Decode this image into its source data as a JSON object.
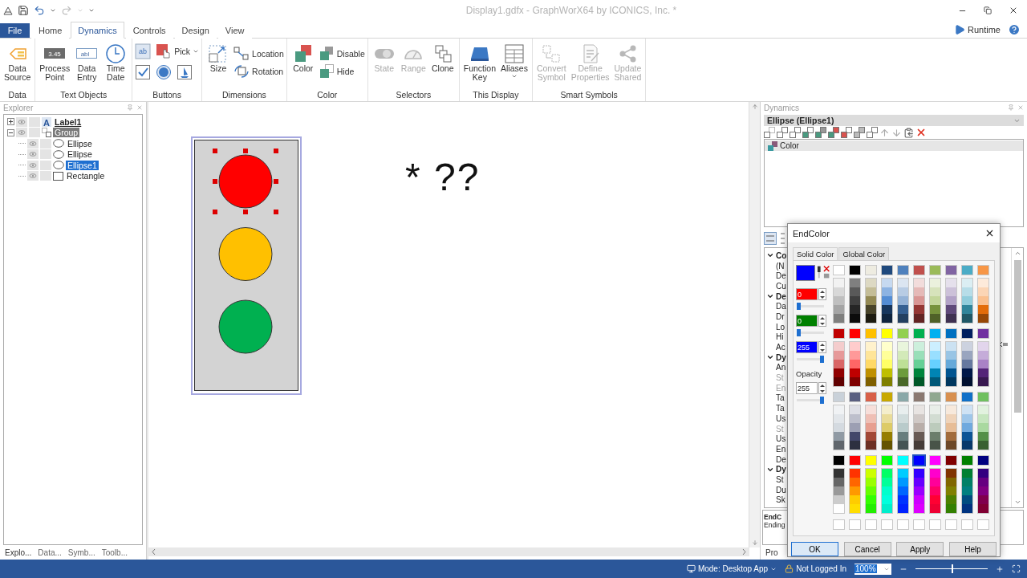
{
  "title_bar": {
    "title": "Display1.gdfx - GraphWorX64 by ICONICS, Inc. *"
  },
  "ribbon": {
    "file_tab": "File",
    "tabs": [
      {
        "label": "Home",
        "selected": false
      },
      {
        "label": "Dynamics",
        "selected": true
      },
      {
        "label": "Controls",
        "selected": false
      },
      {
        "label": "Design",
        "selected": false
      },
      {
        "label": "View",
        "selected": false
      }
    ],
    "runtime": "Runtime",
    "groups": [
      {
        "name": "Data",
        "items": [
          {
            "kind": "large",
            "label": "Data\nSource",
            "disabled": false
          }
        ]
      },
      {
        "name": "Text Objects",
        "items": [
          {
            "kind": "large",
            "label": "Process\nPoint",
            "icon_text": "3.45",
            "disabled": false
          },
          {
            "kind": "large",
            "label": "Data\nEntry",
            "icon_text": "abl",
            "disabled": false
          },
          {
            "kind": "large",
            "label": "Time\nDate",
            "disabled": false
          }
        ]
      },
      {
        "name": "Buttons",
        "items": [
          {
            "kind": "grid",
            "rows": [
              [
                {
                  "icon_text": "ab"
                },
                {
                  "label": "Pick",
                  "dropdown": true
                }
              ],
              [
                {},
                {},
                {}
              ]
            ]
          }
        ]
      },
      {
        "name": "Dimensions",
        "items": [
          {
            "kind": "large",
            "label": "Size",
            "disabled": false
          },
          {
            "kind": "stack",
            "items": [
              {
                "label": "Location"
              },
              {
                "label": "Rotation"
              }
            ]
          }
        ]
      },
      {
        "name": "Color",
        "items": [
          {
            "kind": "large",
            "label": "Color",
            "disabled": false
          },
          {
            "kind": "stack",
            "items": [
              {
                "label": "Disable"
              },
              {
                "label": "Hide"
              }
            ]
          }
        ]
      },
      {
        "name": "Selectors",
        "items": [
          {
            "kind": "large",
            "label": "State",
            "disabled": true
          },
          {
            "kind": "large",
            "label": "Range",
            "disabled": true
          },
          {
            "kind": "large",
            "label": "Clone",
            "disabled": false
          }
        ]
      },
      {
        "name": "This Display",
        "items": [
          {
            "kind": "large",
            "label": "Function\nKey",
            "disabled": false
          },
          {
            "kind": "large",
            "label": "Aliases",
            "dropdown": true,
            "disabled": false
          }
        ]
      },
      {
        "name": "Smart Symbols",
        "items": [
          {
            "kind": "large",
            "label": "Convert\nSymbol",
            "disabled": true
          },
          {
            "kind": "large",
            "label": "Define\nProperties",
            "disabled": true
          },
          {
            "kind": "large",
            "label": "Update\nShared",
            "disabled": true
          }
        ]
      }
    ]
  },
  "explorer": {
    "title": "Explorer",
    "tree": [
      {
        "label": "Label1",
        "kind": "label",
        "icon_text": "A",
        "selected": false,
        "contains_selection": false,
        "expanded": false
      },
      {
        "label": "Group",
        "kind": "group",
        "selected": false,
        "contains_selection": true,
        "expanded": true,
        "children": [
          {
            "label": "Ellipse",
            "kind": "ellipse",
            "selected": false
          },
          {
            "label": "Ellipse",
            "kind": "ellipse",
            "selected": false
          },
          {
            "label": "Ellipse1",
            "kind": "ellipse",
            "selected": true
          },
          {
            "label": "Rectangle",
            "kind": "rectangle",
            "selected": false
          }
        ]
      }
    ],
    "tabs": [
      {
        "label": "Explo...",
        "selected": true
      },
      {
        "label": "Data...",
        "selected": false
      },
      {
        "label": "Symb...",
        "selected": false
      },
      {
        "label": "Toolb...",
        "selected": false
      }
    ]
  },
  "canvas": {
    "housing": {
      "color": "#d3d3d3",
      "selected": true
    },
    "lights": [
      {
        "color": "#ff0000",
        "selected": true
      },
      {
        "color": "#ffc000",
        "selected": false
      },
      {
        "color": "#00b050",
        "selected": false
      }
    ],
    "label": "* ??"
  },
  "dynamics": {
    "title": "Dynamics",
    "object": "Ellipse (Ellipse1)",
    "list": [
      {
        "label": "Color",
        "selected": true
      }
    ],
    "properties": [
      {
        "text": "Co",
        "kind": "category"
      },
      {
        "text": "(N",
        "kind": "item"
      },
      {
        "text": "De",
        "kind": "item"
      },
      {
        "text": "Cu",
        "kind": "item"
      },
      {
        "text": "De",
        "kind": "category"
      },
      {
        "text": "Da",
        "kind": "item"
      },
      {
        "text": "Dr",
        "kind": "item"
      },
      {
        "text": "Lo",
        "kind": "item"
      },
      {
        "text": "Hi",
        "kind": "item"
      },
      {
        "text": "Ac",
        "kind": "item"
      },
      {
        "text": "Dy",
        "kind": "category"
      },
      {
        "text": "An",
        "kind": "item"
      },
      {
        "text": "St",
        "kind": "disabled"
      },
      {
        "text": "En",
        "kind": "disabled"
      },
      {
        "text": "Ta",
        "kind": "item"
      },
      {
        "text": "Ta",
        "kind": "item"
      },
      {
        "text": "Us",
        "kind": "item"
      },
      {
        "text": "St",
        "kind": "disabled"
      },
      {
        "text": "Us",
        "kind": "item"
      },
      {
        "text": "En",
        "kind": "item"
      },
      {
        "text": "De",
        "kind": "item"
      },
      {
        "text": "Dy",
        "kind": "category"
      },
      {
        "text": "St",
        "kind": "item"
      },
      {
        "text": "Du",
        "kind": "item"
      },
      {
        "text": "Sk",
        "kind": "item"
      }
    ],
    "description": {
      "title": "EndC",
      "text": "Ending"
    },
    "tabs": [
      {
        "label": "Pro",
        "selected": true
      }
    ]
  },
  "dialog": {
    "title": "EndColor",
    "tabs": [
      {
        "label": "Solid Color",
        "selected": true
      },
      {
        "label": "Global Color",
        "selected": false
      }
    ],
    "preview": {
      "color": "#0000ff"
    },
    "channels": [
      {
        "kind": "red",
        "value": "0",
        "level": 0
      },
      {
        "kind": "green",
        "value": "0",
        "level": 0
      },
      {
        "kind": "blue",
        "value": "255",
        "level": 1
      }
    ],
    "opacity": {
      "label": "Opacity",
      "value": "255",
      "level": 1
    },
    "palette": [
      {
        "header": [
          {
            "color": "#ffffff",
            "selected": false
          },
          {
            "color": "#000000",
            "selected": false
          },
          {
            "color": "#eeece1",
            "selected": false
          },
          {
            "color": "#1f497d",
            "selected": false
          },
          {
            "color": "#4f81bd",
            "selected": false
          },
          {
            "color": "#c0504d",
            "selected": false
          },
          {
            "color": "#9bbb59",
            "selected": false
          },
          {
            "color": "#8064a2",
            "selected": false
          },
          {
            "color": "#4bacc6",
            "selected": false
          },
          {
            "color": "#f79646",
            "selected": false
          }
        ],
        "shades": [
          [
            {
              "color": "#f2f2f2"
            },
            {
              "color": "#7f7f7f"
            },
            {
              "color": "#ddd9c3"
            },
            {
              "color": "#c6d9f0"
            },
            {
              "color": "#dbe5f1"
            },
            {
              "color": "#f2dcdb"
            },
            {
              "color": "#ebf1dd"
            },
            {
              "color": "#e5e0ec"
            },
            {
              "color": "#dbeef3"
            },
            {
              "color": "#fdeada"
            }
          ],
          [
            {
              "color": "#d8d8d8"
            },
            {
              "color": "#595959"
            },
            {
              "color": "#c4bd97"
            },
            {
              "color": "#8db3e2"
            },
            {
              "color": "#b8cce4"
            },
            {
              "color": "#e5b9b7"
            },
            {
              "color": "#d7e3bc"
            },
            {
              "color": "#ccc1d9"
            },
            {
              "color": "#b7dde8"
            },
            {
              "color": "#fbd5b5"
            }
          ],
          [
            {
              "color": "#bfbfbf"
            },
            {
              "color": "#3f3f3f"
            },
            {
              "color": "#938953"
            },
            {
              "color": "#548dd4"
            },
            {
              "color": "#95b3d7"
            },
            {
              "color": "#d99694"
            },
            {
              "color": "#c3d69b"
            },
            {
              "color": "#b2a2c7"
            },
            {
              "color": "#92cddc"
            },
            {
              "color": "#fac08f"
            }
          ],
          [
            {
              "color": "#a5a5a5"
            },
            {
              "color": "#262626"
            },
            {
              "color": "#494429"
            },
            {
              "color": "#17365d"
            },
            {
              "color": "#366092"
            },
            {
              "color": "#953734"
            },
            {
              "color": "#76923c"
            },
            {
              "color": "#5f497a"
            },
            {
              "color": "#31859b"
            },
            {
              "color": "#e36c09"
            }
          ],
          [
            {
              "color": "#7f7f7e"
            },
            {
              "color": "#0c0c0c"
            },
            {
              "color": "#1d1b10"
            },
            {
              "color": "#0f243e"
            },
            {
              "color": "#244061"
            },
            {
              "color": "#632423"
            },
            {
              "color": "#4f6128"
            },
            {
              "color": "#3f3151"
            },
            {
              "color": "#205867"
            },
            {
              "color": "#974806"
            }
          ]
        ]
      },
      {
        "header": [
          {
            "color": "#c00000",
            "selected": false
          },
          {
            "color": "#ff0000",
            "selected": false
          },
          {
            "color": "#ffc000",
            "selected": false
          },
          {
            "color": "#ffff00",
            "selected": false
          },
          {
            "color": "#92d050",
            "selected": false
          },
          {
            "color": "#00b050",
            "selected": false
          },
          {
            "color": "#00b0f0",
            "selected": false
          },
          {
            "color": "#0070c0",
            "selected": false
          },
          {
            "color": "#002060",
            "selected": false
          },
          {
            "color": "#7030a0",
            "selected": false
          }
        ],
        "shades": [
          [
            {
              "color": "#f4cccc"
            },
            {
              "color": "#ffcccc"
            },
            {
              "color": "#fff2cc"
            },
            {
              "color": "#ffffcc"
            },
            {
              "color": "#e9f5dc"
            },
            {
              "color": "#ccefdc"
            },
            {
              "color": "#ccefff"
            },
            {
              "color": "#cce2f2"
            },
            {
              "color": "#ccd2df"
            },
            {
              "color": "#e2d5ec"
            }
          ],
          [
            {
              "color": "#e69999"
            },
            {
              "color": "#ff9999"
            },
            {
              "color": "#ffe599"
            },
            {
              "color": "#ffff99"
            },
            {
              "color": "#d3eab9"
            },
            {
              "color": "#99dfb9"
            },
            {
              "color": "#99dfff"
            },
            {
              "color": "#99c5e5"
            },
            {
              "color": "#99a5bf"
            },
            {
              "color": "#c5acd9"
            }
          ],
          [
            {
              "color": "#d96666"
            },
            {
              "color": "#ff6666"
            },
            {
              "color": "#ffd966"
            },
            {
              "color": "#ffff66"
            },
            {
              "color": "#bee096"
            },
            {
              "color": "#66d096"
            },
            {
              "color": "#66d0ff"
            },
            {
              "color": "#66a9d9"
            },
            {
              "color": "#66799f"
            },
            {
              "color": "#a982c6"
            }
          ],
          [
            {
              "color": "#900000"
            },
            {
              "color": "#bf0000"
            },
            {
              "color": "#bf9000"
            },
            {
              "color": "#bfbf00"
            },
            {
              "color": "#6d9c3c"
            },
            {
              "color": "#00843c"
            },
            {
              "color": "#0084b4"
            },
            {
              "color": "#005490"
            },
            {
              "color": "#001848"
            },
            {
              "color": "#542478"
            }
          ],
          [
            {
              "color": "#600000"
            },
            {
              "color": "#800000"
            },
            {
              "color": "#806000"
            },
            {
              "color": "#808000"
            },
            {
              "color": "#496828"
            },
            {
              "color": "#005828"
            },
            {
              "color": "#005878"
            },
            {
              "color": "#003860"
            },
            {
              "color": "#001030"
            },
            {
              "color": "#381850"
            }
          ]
        ]
      },
      {
        "header": [
          {
            "color": "#c9d1d9",
            "selected": false
          },
          {
            "color": "#5a5f80",
            "selected": false
          },
          {
            "color": "#d86048",
            "selected": false
          },
          {
            "color": "#c8a800",
            "selected": false
          },
          {
            "color": "#8aa8a8",
            "selected": false
          },
          {
            "color": "#8a7870",
            "selected": false
          },
          {
            "color": "#90a890",
            "selected": false
          },
          {
            "color": "#d89050",
            "selected": false
          },
          {
            "color": "#1070c8",
            "selected": false
          },
          {
            "color": "#70c060",
            "selected": false
          }
        ],
        "shades": [
          [
            {
              "color": "#f0f2f4"
            },
            {
              "color": "#dedfe6"
            },
            {
              "color": "#f7dfda"
            },
            {
              "color": "#f4eecc"
            },
            {
              "color": "#e8eeee"
            },
            {
              "color": "#e8e4e2"
            },
            {
              "color": "#e9eee9"
            },
            {
              "color": "#f7e9dc"
            },
            {
              "color": "#cfe2f4"
            },
            {
              "color": "#e2f2df"
            }
          ],
          [
            {
              "color": "#e2e6ea"
            },
            {
              "color": "#bdbfcc"
            },
            {
              "color": "#efbfb5"
            },
            {
              "color": "#e9dc99"
            },
            {
              "color": "#d0dcdc"
            },
            {
              "color": "#d0c9c6"
            },
            {
              "color": "#d2dcd2"
            },
            {
              "color": "#efd3b9"
            },
            {
              "color": "#9fc6e9"
            },
            {
              "color": "#c6e6bf"
            }
          ],
          [
            {
              "color": "#d4dae0"
            },
            {
              "color": "#9c9fb3"
            },
            {
              "color": "#e79f90"
            },
            {
              "color": "#ddcb66"
            },
            {
              "color": "#b9cbcb"
            },
            {
              "color": "#b9aea9"
            },
            {
              "color": "#bccbbc"
            },
            {
              "color": "#e7bd96"
            },
            {
              "color": "#70a9de"
            },
            {
              "color": "#a9d9a0"
            }
          ],
          [
            {
              "color": "#909aa4"
            },
            {
              "color": "#43476a"
            },
            {
              "color": "#a24836"
            },
            {
              "color": "#967e00"
            },
            {
              "color": "#687e7e"
            },
            {
              "color": "#685a54"
            },
            {
              "color": "#6c7e6c"
            },
            {
              "color": "#a26c3c"
            },
            {
              "color": "#0c5496"
            },
            {
              "color": "#549048"
            }
          ],
          [
            {
              "color": "#60666c"
            },
            {
              "color": "#2d3040"
            },
            {
              "color": "#6c3024"
            },
            {
              "color": "#645400"
            },
            {
              "color": "#455454"
            },
            {
              "color": "#453c38"
            },
            {
              "color": "#485448"
            },
            {
              "color": "#6c4828"
            },
            {
              "color": "#08386a"
            },
            {
              "color": "#386030"
            }
          ]
        ]
      },
      {
        "header": [
          {
            "color": "#000000",
            "selected": false
          },
          {
            "color": "#ff0000",
            "selected": false
          },
          {
            "color": "#ffff00",
            "selected": false
          },
          {
            "color": "#00ff00",
            "selected": false
          },
          {
            "color": "#00ffff",
            "selected": false
          },
          {
            "color": "#0000ff",
            "selected": true
          },
          {
            "color": "#ff00ff",
            "selected": false
          },
          {
            "color": "#800000",
            "selected": false
          },
          {
            "color": "#008000",
            "selected": false
          },
          {
            "color": "#000080",
            "selected": false
          }
        ],
        "shades": [
          [
            {
              "color": "#333333"
            },
            {
              "color": "#ff3300"
            },
            {
              "color": "#ccff00"
            },
            {
              "color": "#00ff66"
            },
            {
              "color": "#00ccff"
            },
            {
              "color": "#3300ff"
            },
            {
              "color": "#ff00cc"
            },
            {
              "color": "#803300"
            },
            {
              "color": "#008033"
            },
            {
              "color": "#330080"
            }
          ],
          [
            {
              "color": "#666666"
            },
            {
              "color": "#ff6600"
            },
            {
              "color": "#99ff00"
            },
            {
              "color": "#00ff99"
            },
            {
              "color": "#0099ff"
            },
            {
              "color": "#6600ff"
            },
            {
              "color": "#ff0099"
            },
            {
              "color": "#806600"
            },
            {
              "color": "#008066"
            },
            {
              "color": "#660080"
            }
          ],
          [
            {
              "color": "#999999"
            },
            {
              "color": "#ff9900"
            },
            {
              "color": "#66ff00"
            },
            {
              "color": "#00ffcc"
            },
            {
              "color": "#0066ff"
            },
            {
              "color": "#9900ff"
            },
            {
              "color": "#ff0066"
            },
            {
              "color": "#808001"
            },
            {
              "color": "#008080"
            },
            {
              "color": "#800080"
            }
          ],
          [
            {
              "color": "#cccccc"
            },
            {
              "color": "#ffcc00"
            },
            {
              "color": "#33ff00"
            },
            {
              "color": "#00ffdd"
            },
            {
              "color": "#0033ff"
            },
            {
              "color": "#cc00ff"
            },
            {
              "color": "#ff0033"
            },
            {
              "color": "#4d8000"
            },
            {
              "color": "#004d80"
            },
            {
              "color": "#80004d"
            }
          ],
          [
            {
              "color": "#fefefe"
            },
            {
              "color": "#ffdd00"
            },
            {
              "color": "#22ee00"
            },
            {
              "color": "#00eecc"
            },
            {
              "color": "#0022ff"
            },
            {
              "color": "#dd00ff"
            },
            {
              "color": "#ee0033"
            },
            {
              "color": "#338000"
            },
            {
              "color": "#003380"
            },
            {
              "color": "#800033"
            }
          ]
        ]
      }
    ],
    "custom_colors": [
      {
        "color": "#ffffff"
      },
      {
        "color": "#ffffff"
      },
      {
        "color": "#ffffff"
      },
      {
        "color": "#ffffff"
      },
      {
        "color": "#ffffff"
      },
      {
        "color": "#ffffff"
      },
      {
        "color": "#ffffff"
      },
      {
        "color": "#ffffff"
      },
      {
        "color": "#ffffff"
      },
      {
        "color": "#ffffff"
      }
    ],
    "buttons": [
      {
        "label": "OK",
        "focused": true
      },
      {
        "label": "Cancel",
        "focused": false
      },
      {
        "label": "Apply",
        "focused": false
      },
      {
        "label": "Help",
        "focused": false
      }
    ]
  },
  "status_bar": {
    "mode": "Mode: Desktop App",
    "login": "Not Logged In",
    "zoom": "100%",
    "zoom_slider": {
      "level": 0.5
    }
  }
}
